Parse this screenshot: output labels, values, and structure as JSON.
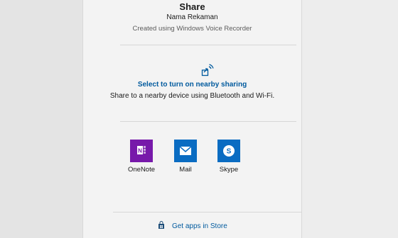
{
  "share": {
    "title": "Share",
    "recording_name": "Nama Rekaman",
    "created_with": "Created using Windows Voice Recorder"
  },
  "nearby": {
    "link_label": "Select to turn on nearby sharing",
    "description": "Share to a nearby device using Bluetooth and Wi-Fi.",
    "icon": "nearby-share-icon"
  },
  "apps": [
    {
      "label": "OneNote",
      "icon": "onenote-icon",
      "color": "#7719aa"
    },
    {
      "label": "Mail",
      "icon": "mail-icon",
      "color": "#0a6cc2"
    },
    {
      "label": "Skype",
      "icon": "skype-icon",
      "color": "#0a6cc2"
    }
  ],
  "store": {
    "label": "Get apps in Store",
    "icon": "store-icon"
  },
  "colors": {
    "link": "#005a9e",
    "panel_bg": "#f3f3f3"
  }
}
